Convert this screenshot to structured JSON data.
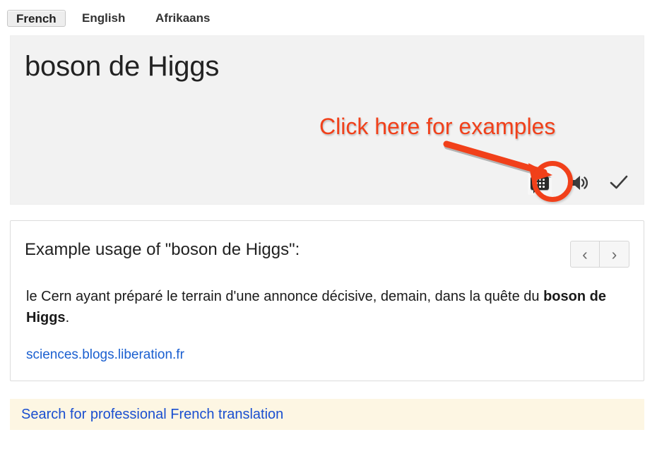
{
  "tabs": [
    {
      "label": "French",
      "active": true
    },
    {
      "label": "English",
      "active": false
    },
    {
      "label": "Afrikaans",
      "active": false
    }
  ],
  "source_panel": {
    "text": "boson de Higgs",
    "actions": {
      "examples_icon": "examples-bubble-icon",
      "listen_icon": "speaker-icon",
      "approve_icon": "checkmark-icon"
    }
  },
  "annotation": {
    "note": "Click here for examples",
    "color": "#f1401a",
    "arrow_icon": "arrow-icon",
    "highlight_icon": "circle-highlight"
  },
  "examples_card": {
    "heading": "Example usage of \"boson de Higgs\":",
    "nav": {
      "prev_label": "‹",
      "next_label": "›"
    },
    "sentence_before": "le Cern ayant préparé le terrain d'une annonce décisive, demain, dans la quête du ",
    "sentence_highlight": "boson de Higgs",
    "sentence_after": ".",
    "source_link": "sciences.blogs.liberation.fr"
  },
  "promo": {
    "link": "Search for professional French translation"
  },
  "colors": {
    "panel_bg": "#f2f2f2",
    "accent_orange": "#f1401a",
    "link_blue": "#1a5fd0",
    "promo_bg": "#fdf6e3"
  }
}
